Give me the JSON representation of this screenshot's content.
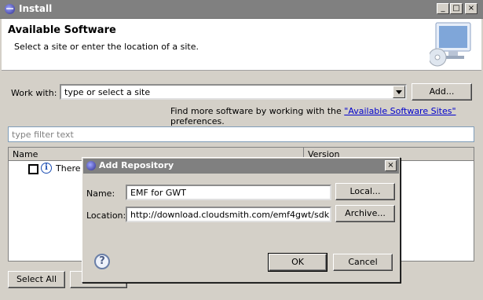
{
  "window": {
    "title": "Install"
  },
  "header": {
    "title": "Available Software",
    "subtitle": "Select a site or enter the location of a site."
  },
  "work_with": {
    "label": "Work with:",
    "value": "type or select a site",
    "add_button": "Add..."
  },
  "find_more": {
    "prefix": "Find more software by working with the ",
    "link": "\"Available Software Sites\"",
    "suffix": " preferences."
  },
  "filter": {
    "placeholder": "type filter text"
  },
  "table": {
    "columns": [
      "Name",
      "Version"
    ],
    "rows": [
      {
        "text": "There i"
      }
    ]
  },
  "bottom_buttons": {
    "select_all": "Select All"
  },
  "dialog": {
    "title": "Add Repository",
    "name_label": "Name:",
    "name_value": "EMF for GWT",
    "local_button": "Local...",
    "location_label": "Location:",
    "location_value": "http://download.cloudsmith.com/emf4gwt/sdk",
    "archive_button": "Archive...",
    "ok_button": "OK",
    "cancel_button": "Cancel"
  }
}
